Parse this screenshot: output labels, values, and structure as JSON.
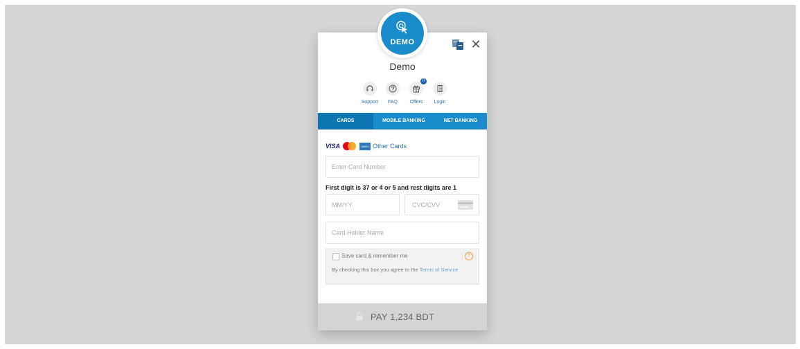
{
  "merchant": {
    "logo_text": "DEMO",
    "name": "Demo"
  },
  "quick_links": [
    {
      "label": "Support",
      "icon": "headset-icon"
    },
    {
      "label": "FAQ",
      "icon": "help-circle-icon"
    },
    {
      "label": "Offers",
      "icon": "gift-icon",
      "badge": "0"
    },
    {
      "label": "Login",
      "icon": "login-icon"
    }
  ],
  "tabs": [
    {
      "label": "CARDS",
      "active": true
    },
    {
      "label": "MOBILE BANKING",
      "active": false
    },
    {
      "label": "NET BANKING",
      "active": false
    }
  ],
  "card_brands": {
    "visa": "VISA",
    "amex": "AMEX",
    "other_link": "Other Cards"
  },
  "form": {
    "card_number_placeholder": "Enter Card Number",
    "hint": "First digit is 37 or 4 or 5 and rest digits are 1",
    "expiry_placeholder": "MM/YY",
    "cvc_placeholder": "CVC/CVV",
    "holder_placeholder": "Card Holder Name"
  },
  "save_card": {
    "label": "Save card & remember me",
    "terms_prefix": "By checking this box you agree to the ",
    "terms_link": "Terms of Service"
  },
  "pay": {
    "label": "PAY 1,234 BDT"
  },
  "colors": {
    "primary": "#1a8ccc",
    "active_tab": "#0e76b2",
    "link": "#2c74b5",
    "pay_disabled": "#d4d4d4"
  }
}
